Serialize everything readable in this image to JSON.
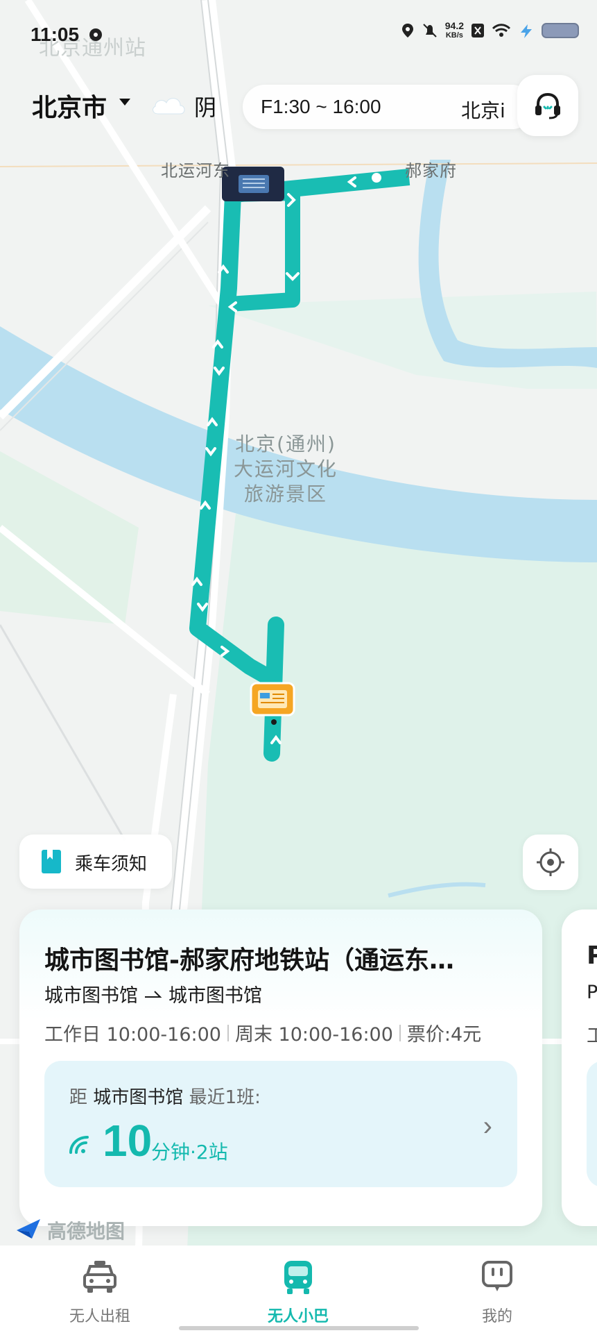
{
  "status_bar": {
    "time": "11:05",
    "net_speed_value": "94.2",
    "net_speed_unit": "KB/s",
    "icons": [
      "settings-icon",
      "location-icon",
      "mute-icon",
      "sim-icon",
      "wifi-icon",
      "bolt-icon",
      "battery-icon"
    ]
  },
  "map": {
    "labels": {
      "top_faded": "北京通州站",
      "beiyunhe_east": "北运河东",
      "haojiafu": "郝家府",
      "scenic_line1": "北京(通州)",
      "scenic_line2": "大运河文化",
      "scenic_line3": "旅游景区"
    },
    "route_color": "#19bdb3",
    "river_color": "#b9dff0",
    "park_color": "#dff2ea"
  },
  "header": {
    "city": "北京市",
    "weather": "阴",
    "hours": "F1:30 ~ 16:00",
    "hours_ticker": "北京i"
  },
  "buttons": {
    "notice": "乘车须知"
  },
  "route_card": {
    "title": "城市图书馆-郝家府地铁站（通运东…",
    "from": "城市图书馆",
    "to": "城市图书馆",
    "weekday": "工作日 10:00-16:00",
    "weekend": "周末 10:00-16:00",
    "price": "票价:4元",
    "eta_prefix": "距",
    "eta_station": "城市图书馆",
    "eta_suffix": "最近1班:",
    "eta_minutes": "10",
    "eta_unit": "分钟·2站"
  },
  "peek_card": {
    "title": "P",
    "stops": "P",
    "sched": "工"
  },
  "amap_logo": "高德地图",
  "tabs": [
    {
      "label": "无人出租",
      "active": false
    },
    {
      "label": "无人小巴",
      "active": true
    },
    {
      "label": "我的",
      "active": false
    }
  ],
  "colors": {
    "accent": "#14b9ae",
    "eta_bg": "#e4f5fa"
  }
}
